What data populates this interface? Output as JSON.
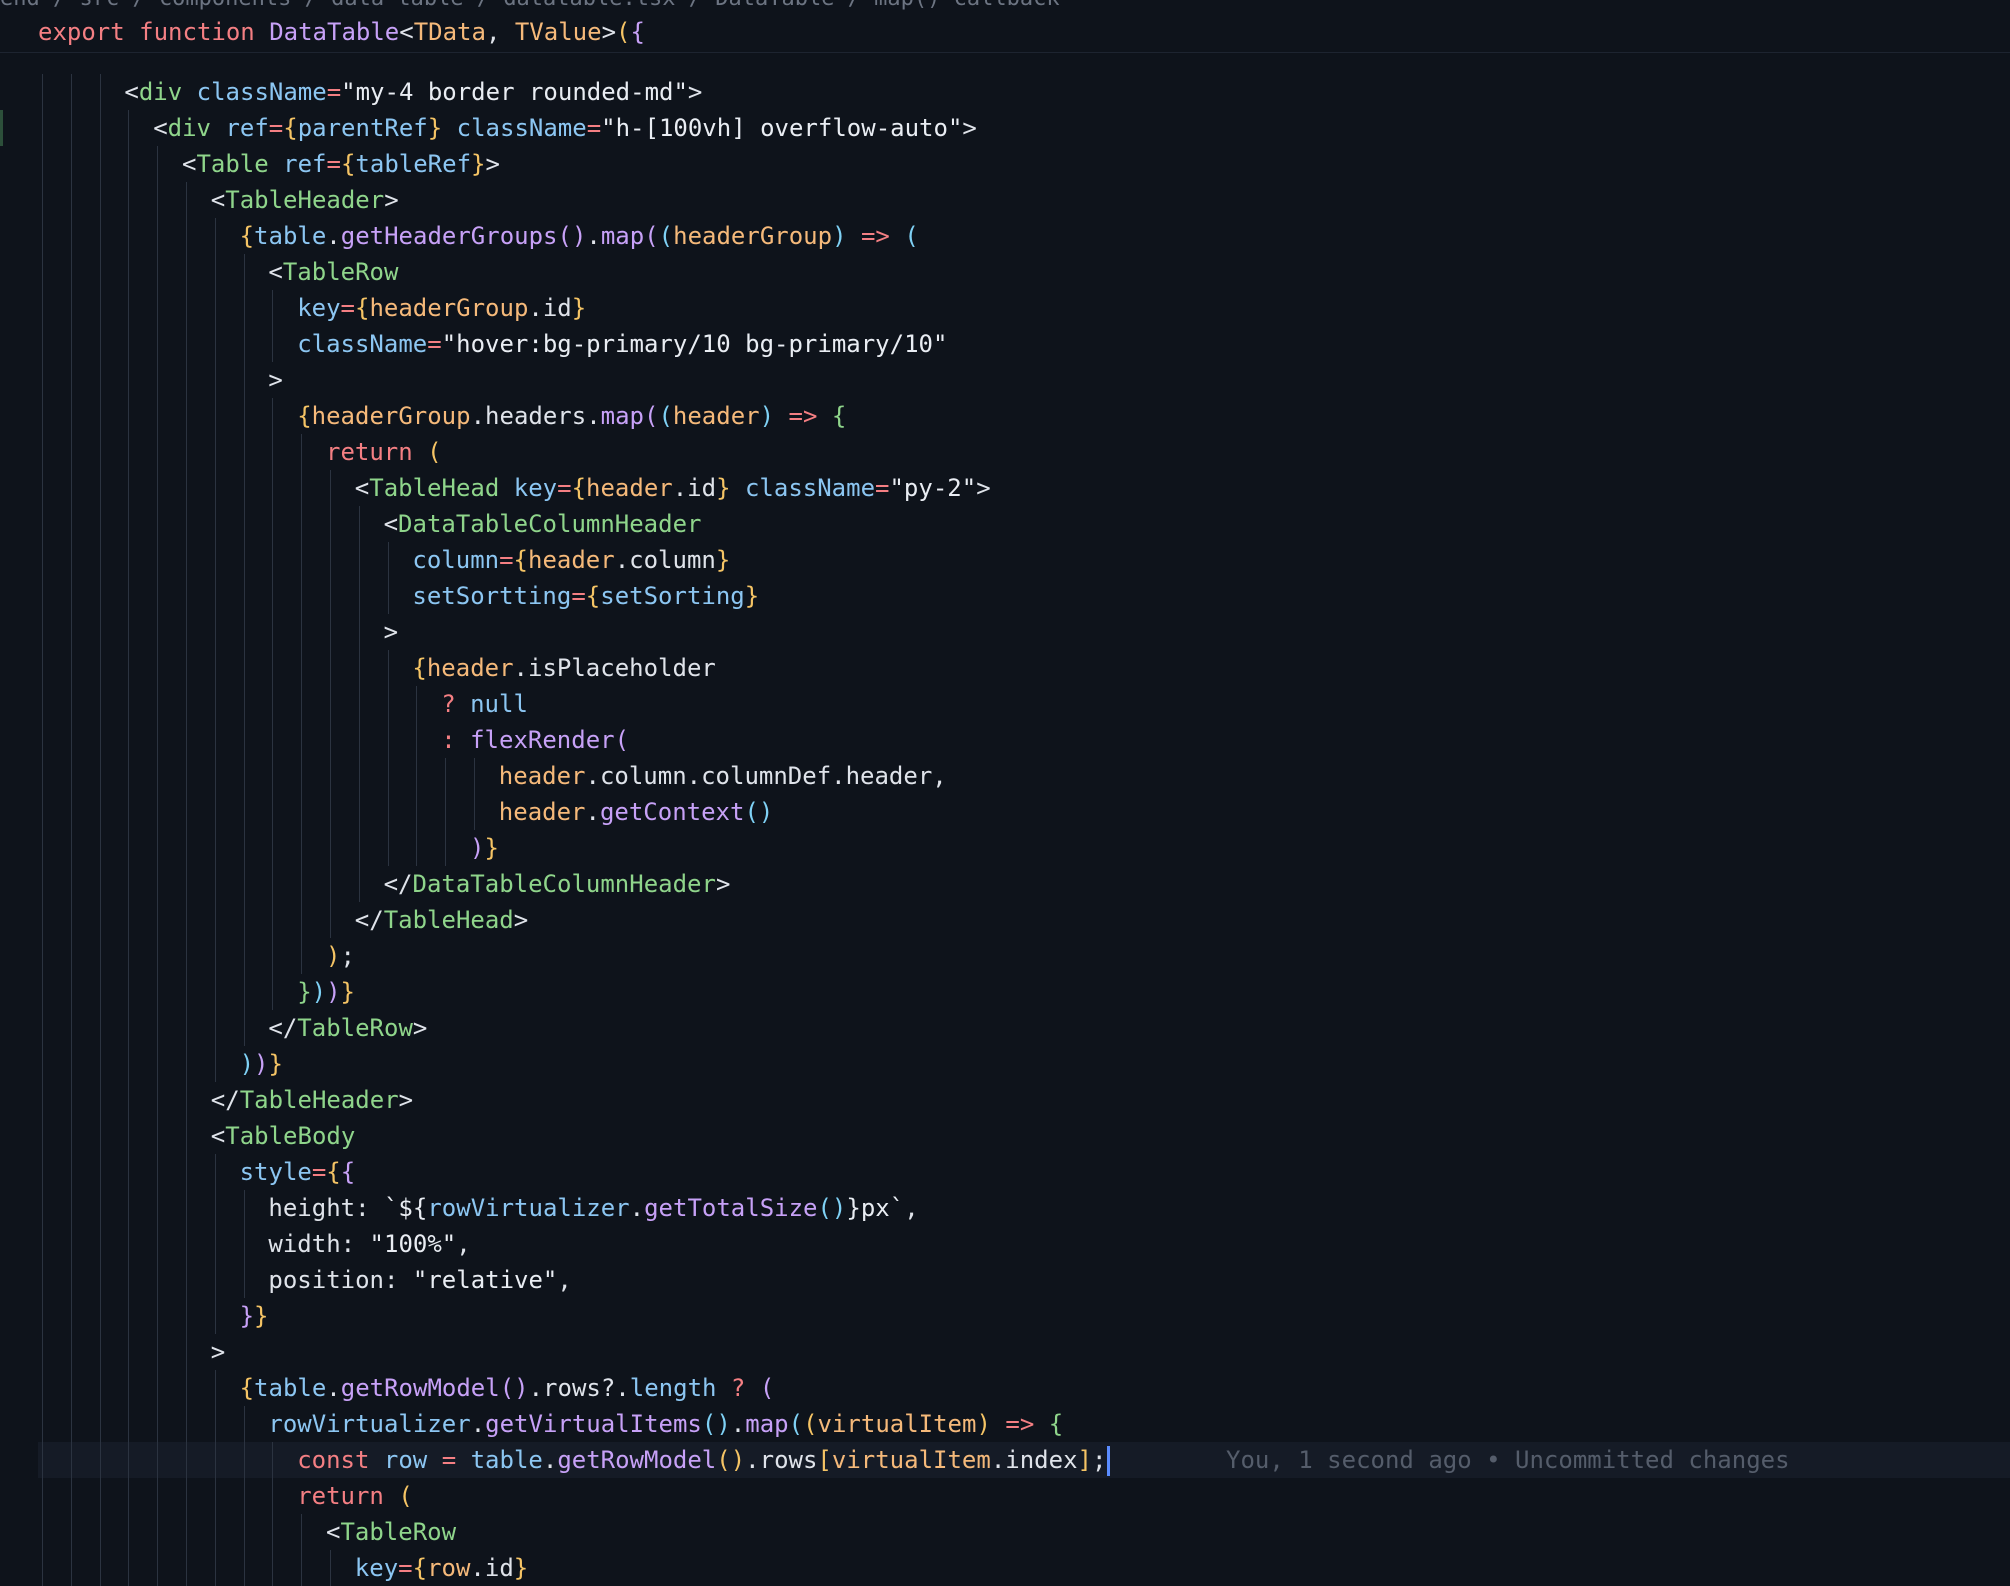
{
  "breadcrumb": "end / src / components / data-table / datatable.tsx / DataTable / map() callback",
  "blame": "You, 1 second ago • Uncommitted changes",
  "colors": {
    "background": "#0e131b",
    "keyword": "#f47f83",
    "function": "#c7a1f7",
    "tag": "#8fd58b",
    "attribute": "#8cc6f2",
    "variable": "#f5b97a",
    "caret": "#5a8cff"
  },
  "lines": [
    {
      "indent": 0,
      "tokens": [
        [
          "kw",
          "export "
        ],
        [
          "kw",
          "function "
        ],
        [
          "fn",
          "DataTable"
        ],
        [
          "pun",
          "<"
        ],
        [
          "type",
          "TData"
        ],
        [
          "pun",
          ", "
        ],
        [
          "type",
          "TValue"
        ],
        [
          "pun",
          ">"
        ],
        [
          "br1",
          "("
        ],
        [
          "br2",
          "{"
        ]
      ]
    },
    {
      "indent": 3,
      "tokens": [
        [
          "pun",
          "<"
        ],
        [
          "tag",
          "div "
        ],
        [
          "attr",
          "className"
        ],
        [
          "op",
          "="
        ],
        [
          "str",
          "\"my-4 border rounded-md\""
        ],
        [
          "pun",
          ">"
        ]
      ]
    },
    {
      "indent": 4,
      "tokens": [
        [
          "pun",
          "<"
        ],
        [
          "tag",
          "div "
        ],
        [
          "attr",
          "ref"
        ],
        [
          "op",
          "="
        ],
        [
          "br1",
          "{"
        ],
        [
          "prop",
          "parentRef"
        ],
        [
          "br1",
          "}"
        ],
        [
          "attr",
          " className"
        ],
        [
          "op",
          "="
        ],
        [
          "str",
          "\"h-[100vh] overflow-auto\""
        ],
        [
          "pun",
          ">"
        ]
      ]
    },
    {
      "indent": 5,
      "tokens": [
        [
          "pun",
          "<"
        ],
        [
          "tag",
          "Table "
        ],
        [
          "attr",
          "ref"
        ],
        [
          "op",
          "="
        ],
        [
          "br1",
          "{"
        ],
        [
          "prop",
          "tableRef"
        ],
        [
          "br1",
          "}"
        ],
        [
          "pun",
          ">"
        ]
      ]
    },
    {
      "indent": 6,
      "tokens": [
        [
          "pun",
          "<"
        ],
        [
          "tag",
          "TableHeader"
        ],
        [
          "pun",
          ">"
        ]
      ]
    },
    {
      "indent": 7,
      "tokens": [
        [
          "br1",
          "{"
        ],
        [
          "prop",
          "table"
        ],
        [
          "pun",
          "."
        ],
        [
          "fn",
          "getHeaderGroups"
        ],
        [
          "br2",
          "()"
        ],
        [
          "pun",
          "."
        ],
        [
          "fn",
          "map"
        ],
        [
          "br2",
          "("
        ],
        [
          "br3",
          "("
        ],
        [
          "var",
          "headerGroup"
        ],
        [
          "br3",
          ")"
        ],
        [
          "op",
          " => "
        ],
        [
          "br3",
          "("
        ]
      ]
    },
    {
      "indent": 8,
      "tokens": [
        [
          "pun",
          "<"
        ],
        [
          "tag",
          "TableRow"
        ]
      ]
    },
    {
      "indent": 9,
      "tokens": [
        [
          "attr",
          "key"
        ],
        [
          "op",
          "="
        ],
        [
          "br1",
          "{"
        ],
        [
          "var",
          "headerGroup"
        ],
        [
          "pun",
          ".id"
        ],
        [
          "br1",
          "}"
        ]
      ]
    },
    {
      "indent": 9,
      "tokens": [
        [
          "attr",
          "className"
        ],
        [
          "op",
          "="
        ],
        [
          "str",
          "\"hover:bg-primary/10 bg-primary/10\""
        ]
      ]
    },
    {
      "indent": 8,
      "tokens": [
        [
          "pun",
          ">"
        ]
      ]
    },
    {
      "indent": 9,
      "tokens": [
        [
          "br1",
          "{"
        ],
        [
          "var",
          "headerGroup"
        ],
        [
          "pun",
          ".headers."
        ],
        [
          "fn",
          "map"
        ],
        [
          "br2",
          "("
        ],
        [
          "br3",
          "("
        ],
        [
          "var",
          "header"
        ],
        [
          "br3",
          ")"
        ],
        [
          "op",
          " => "
        ],
        [
          "green",
          "{"
        ]
      ]
    },
    {
      "indent": 10,
      "tokens": [
        [
          "kw",
          "return "
        ],
        [
          "br1",
          "("
        ]
      ]
    },
    {
      "indent": 11,
      "tokens": [
        [
          "pun",
          "<"
        ],
        [
          "tag",
          "TableHead "
        ],
        [
          "attr",
          "key"
        ],
        [
          "op",
          "="
        ],
        [
          "br1",
          "{"
        ],
        [
          "var",
          "header"
        ],
        [
          "pun",
          ".id"
        ],
        [
          "br1",
          "}"
        ],
        [
          "attr",
          " className"
        ],
        [
          "op",
          "="
        ],
        [
          "str",
          "\"py-2\""
        ],
        [
          "pun",
          ">"
        ]
      ]
    },
    {
      "indent": 12,
      "tokens": [
        [
          "pun",
          "<"
        ],
        [
          "tag",
          "DataTableColumnHeader"
        ]
      ]
    },
    {
      "indent": 13,
      "tokens": [
        [
          "attr",
          "column"
        ],
        [
          "op",
          "="
        ],
        [
          "br1",
          "{"
        ],
        [
          "var",
          "header"
        ],
        [
          "pun",
          ".column"
        ],
        [
          "br1",
          "}"
        ]
      ]
    },
    {
      "indent": 13,
      "tokens": [
        [
          "attr",
          "setSortting"
        ],
        [
          "op",
          "="
        ],
        [
          "br1",
          "{"
        ],
        [
          "prop",
          "setSorting"
        ],
        [
          "br1",
          "}"
        ]
      ]
    },
    {
      "indent": 12,
      "tokens": [
        [
          "pun",
          ">"
        ]
      ]
    },
    {
      "indent": 13,
      "tokens": [
        [
          "br1",
          "{"
        ],
        [
          "var",
          "header"
        ],
        [
          "pun",
          ".isPlaceholder"
        ]
      ]
    },
    {
      "indent": 14,
      "tokens": [
        [
          "op",
          "? "
        ],
        [
          "prop",
          "null"
        ]
      ]
    },
    {
      "indent": 14,
      "tokens": [
        [
          "op",
          ": "
        ],
        [
          "fn",
          "flexRender"
        ],
        [
          "br2",
          "("
        ]
      ]
    },
    {
      "indent": 16,
      "tokens": [
        [
          "var",
          "header"
        ],
        [
          "pun",
          ".column.columnDef.header,"
        ]
      ]
    },
    {
      "indent": 16,
      "tokens": [
        [
          "var",
          "header"
        ],
        [
          "pun",
          "."
        ],
        [
          "fn",
          "getContext"
        ],
        [
          "br3",
          "()"
        ]
      ]
    },
    {
      "indent": 15,
      "tokens": [
        [
          "br2",
          ")"
        ],
        [
          "br1",
          "}"
        ]
      ]
    },
    {
      "indent": 12,
      "tokens": [
        [
          "pun",
          "</"
        ],
        [
          "tag",
          "DataTableColumnHeader"
        ],
        [
          "pun",
          ">"
        ]
      ]
    },
    {
      "indent": 11,
      "tokens": [
        [
          "pun",
          "</"
        ],
        [
          "tag",
          "TableHead"
        ],
        [
          "pun",
          ">"
        ]
      ]
    },
    {
      "indent": 10,
      "tokens": [
        [
          "br1",
          ")"
        ],
        [
          "pun",
          ";"
        ]
      ]
    },
    {
      "indent": 9,
      "tokens": [
        [
          "green",
          "}"
        ],
        [
          "br3",
          ")"
        ],
        [
          "br2",
          ")"
        ],
        [
          "br1",
          "}"
        ]
      ]
    },
    {
      "indent": 8,
      "tokens": [
        [
          "pun",
          "</"
        ],
        [
          "tag",
          "TableRow"
        ],
        [
          "pun",
          ">"
        ]
      ]
    },
    {
      "indent": 7,
      "tokens": [
        [
          "br3",
          ")"
        ],
        [
          "br2",
          ")"
        ],
        [
          "br1",
          "}"
        ]
      ]
    },
    {
      "indent": 6,
      "tokens": [
        [
          "pun",
          "</"
        ],
        [
          "tag",
          "TableHeader"
        ],
        [
          "pun",
          ">"
        ]
      ]
    },
    {
      "indent": 6,
      "tokens": [
        [
          "pun",
          "<"
        ],
        [
          "tag",
          "TableBody"
        ]
      ]
    },
    {
      "indent": 7,
      "tokens": [
        [
          "attr",
          "style"
        ],
        [
          "op",
          "="
        ],
        [
          "br1",
          "{"
        ],
        [
          "br2",
          "{"
        ]
      ]
    },
    {
      "indent": 8,
      "tokens": [
        [
          "pun",
          "height: "
        ],
        [
          "str",
          "`${"
        ],
        [
          "prop",
          "rowVirtualizer"
        ],
        [
          "pun",
          "."
        ],
        [
          "fn",
          "getTotalSize"
        ],
        [
          "br3",
          "()"
        ],
        [
          "str",
          "}px`"
        ],
        [
          "pun",
          ","
        ]
      ]
    },
    {
      "indent": 8,
      "tokens": [
        [
          "pun",
          "width: "
        ],
        [
          "str",
          "\"100%\""
        ],
        [
          "pun",
          ","
        ]
      ]
    },
    {
      "indent": 8,
      "tokens": [
        [
          "pun",
          "position: "
        ],
        [
          "str",
          "\"relative\""
        ],
        [
          "pun",
          ","
        ]
      ]
    },
    {
      "indent": 7,
      "tokens": [
        [
          "br2",
          "}"
        ],
        [
          "br1",
          "}"
        ]
      ]
    },
    {
      "indent": 6,
      "tokens": [
        [
          "pun",
          ">"
        ]
      ]
    },
    {
      "indent": 7,
      "tokens": [
        [
          "br1",
          "{"
        ],
        [
          "prop",
          "table"
        ],
        [
          "pun",
          "."
        ],
        [
          "fn",
          "getRowModel"
        ],
        [
          "br2",
          "()"
        ],
        [
          "pun",
          ".rows?."
        ],
        [
          "prop",
          "length"
        ],
        [
          "op",
          " ? "
        ],
        [
          "br2",
          "("
        ]
      ]
    },
    {
      "indent": 8,
      "tokens": [
        [
          "prop",
          "rowVirtualizer"
        ],
        [
          "pun",
          "."
        ],
        [
          "fn",
          "getVirtualItems"
        ],
        [
          "br3",
          "()"
        ],
        [
          "pun",
          "."
        ],
        [
          "fn",
          "map"
        ],
        [
          "br3",
          "("
        ],
        [
          "br1",
          "("
        ],
        [
          "var",
          "virtualItem"
        ],
        [
          "br1",
          ")"
        ],
        [
          "op",
          " => "
        ],
        [
          "green",
          "{"
        ]
      ]
    },
    {
      "indent": 9,
      "tokens": [
        [
          "kw",
          "const "
        ],
        [
          "prop",
          "row"
        ],
        [
          "op",
          " = "
        ],
        [
          "prop",
          "table"
        ],
        [
          "pun",
          "."
        ],
        [
          "fn",
          "getRowModel"
        ],
        [
          "br1",
          "()"
        ],
        [
          "pun",
          ".rows"
        ],
        [
          "br1",
          "["
        ],
        [
          "var",
          "virtualItem"
        ],
        [
          "pun",
          ".index"
        ],
        [
          "br1",
          "]"
        ],
        [
          "pun",
          ";"
        ]
      ],
      "current": true
    },
    {
      "indent": 9,
      "tokens": [
        [
          "kw",
          "return "
        ],
        [
          "br1",
          "("
        ]
      ]
    },
    {
      "indent": 10,
      "tokens": [
        [
          "pun",
          "<"
        ],
        [
          "tag",
          "TableRow"
        ]
      ]
    },
    {
      "indent": 11,
      "tokens": [
        [
          "attr",
          "key"
        ],
        [
          "op",
          "="
        ],
        [
          "br1",
          "{"
        ],
        [
          "var",
          "row"
        ],
        [
          "pun",
          ".id"
        ],
        [
          "br1",
          "}"
        ]
      ]
    }
  ]
}
